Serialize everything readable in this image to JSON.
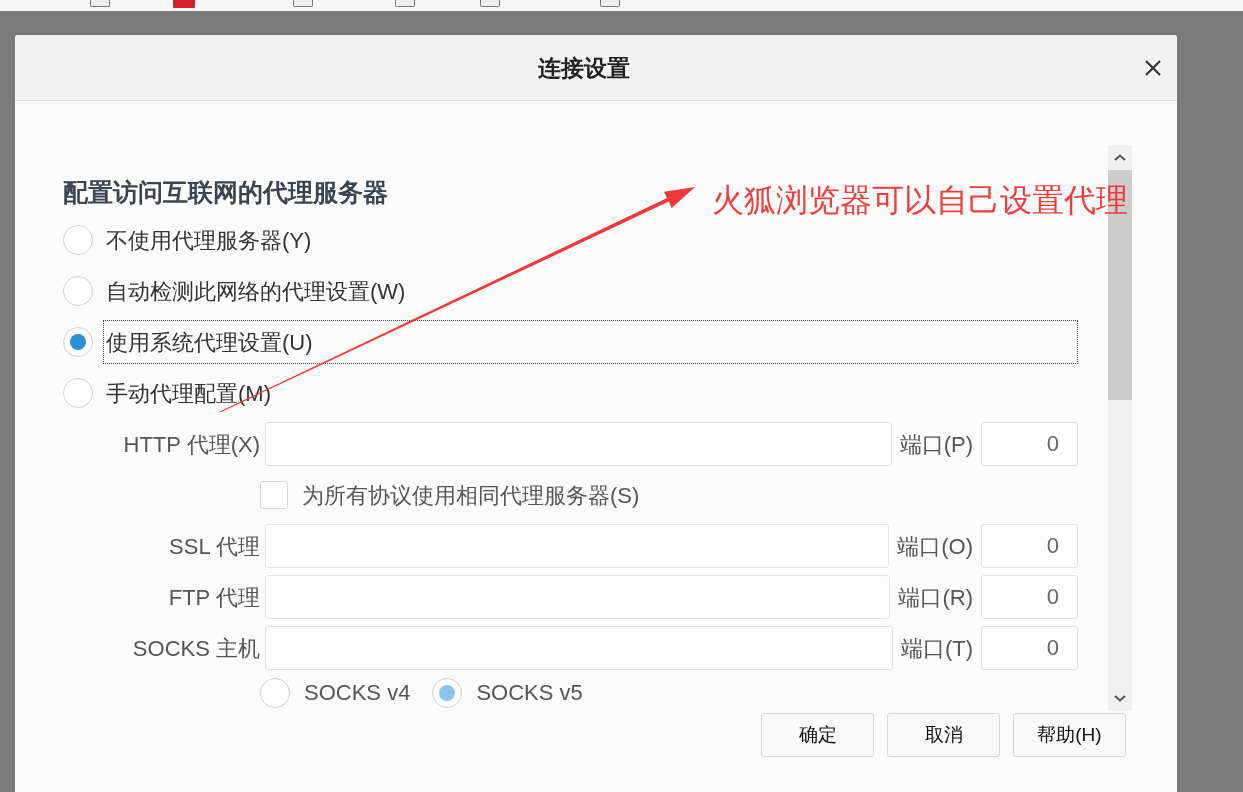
{
  "dialog": {
    "title": "连接设置"
  },
  "section_heading": "配置访问互联网的代理服务器",
  "proxy_modes": [
    {
      "label": "不使用代理服务器(Y)",
      "selected": false,
      "focused": false
    },
    {
      "label": "自动检测此网络的代理设置(W)",
      "selected": false,
      "focused": false
    },
    {
      "label": "使用系统代理设置(U)",
      "selected": true,
      "focused": true
    },
    {
      "label": "手动代理配置(M)",
      "selected": false,
      "focused": false
    }
  ],
  "manual_proxy": {
    "disabled": true,
    "rows": [
      {
        "kind": "proxy",
        "label": "HTTP 代理(X)",
        "port_label": "端口(P)",
        "port": "0"
      },
      {
        "kind": "checkbox",
        "label": "为所有协议使用相同代理服务器(S)",
        "checked": false
      },
      {
        "kind": "proxy",
        "label": "SSL 代理",
        "port_label": "端口(O)",
        "port": "0"
      },
      {
        "kind": "proxy",
        "label": "FTP 代理",
        "port_label": "端口(R)",
        "port": "0"
      },
      {
        "kind": "proxy",
        "label": "SOCKS 主机",
        "port_label": "端口(T)",
        "port": "0"
      }
    ],
    "socks_versions": [
      {
        "label": "SOCKS v4",
        "selected": false
      },
      {
        "label": "SOCKS v5",
        "selected": true
      }
    ]
  },
  "buttons": [
    {
      "label": "确定"
    },
    {
      "label": "取消"
    },
    {
      "label": "帮助(H)"
    }
  ],
  "annotation": {
    "text": "火狐浏览器可以自己设置代理"
  }
}
